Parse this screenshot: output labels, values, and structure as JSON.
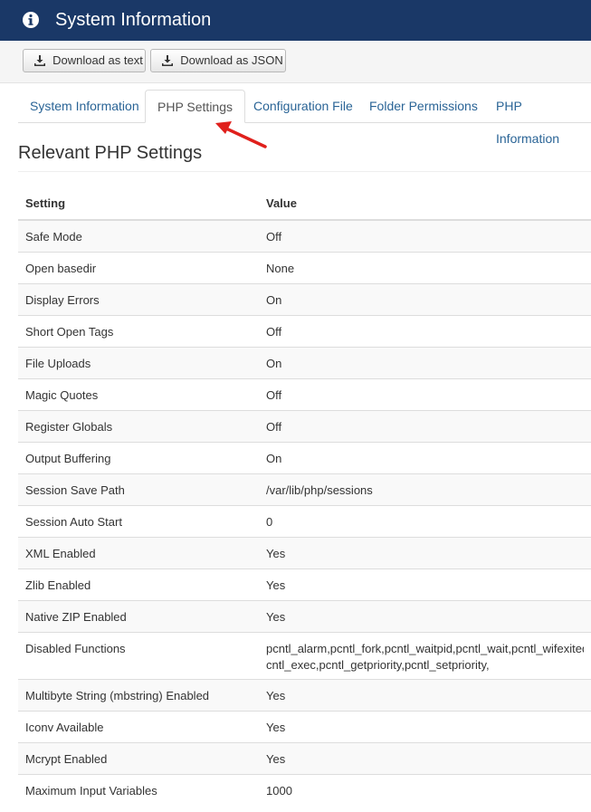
{
  "header": {
    "title": "System Information",
    "icon": "info-icon"
  },
  "toolbar": {
    "download_text": "Download as text",
    "download_json": "Download as JSON"
  },
  "tabs": [
    {
      "label": "System Information"
    },
    {
      "label": "PHP Settings",
      "active": true
    },
    {
      "label": "Configuration File"
    },
    {
      "label": "Folder Permissions"
    },
    {
      "label": "PHP Information"
    }
  ],
  "section": {
    "title": "Relevant PHP Settings"
  },
  "table": {
    "headers": {
      "setting": "Setting",
      "value": "Value"
    },
    "rows": [
      {
        "setting": "Safe Mode",
        "value": "Off"
      },
      {
        "setting": "Open basedir",
        "value": "None"
      },
      {
        "setting": "Display Errors",
        "value": "On"
      },
      {
        "setting": "Short Open Tags",
        "value": "Off"
      },
      {
        "setting": "File Uploads",
        "value": "On"
      },
      {
        "setting": "Magic Quotes",
        "value": "Off"
      },
      {
        "setting": "Register Globals",
        "value": "Off"
      },
      {
        "setting": "Output Buffering",
        "value": "On"
      },
      {
        "setting": "Session Save Path",
        "value": "/var/lib/php/sessions"
      },
      {
        "setting": "Session Auto Start",
        "value": "0"
      },
      {
        "setting": "XML Enabled",
        "value": "Yes"
      },
      {
        "setting": "Zlib Enabled",
        "value": "Yes"
      },
      {
        "setting": "Native ZIP Enabled",
        "value": "Yes"
      },
      {
        "setting": "Disabled Functions",
        "value_line1": "pcntl_alarm,pcntl_fork,pcntl_waitpid,pcntl_wait,pcntl_wifexited,",
        "value_line2": "cntl_exec,pcntl_getpriority,pcntl_setpriority,"
      },
      {
        "setting": "Multibyte String (mbstring) Enabled",
        "value": "Yes"
      },
      {
        "setting": "Iconv Available",
        "value": "Yes"
      },
      {
        "setting": "Mcrypt Enabled",
        "value": "Yes"
      },
      {
        "setting": "Maximum Input Variables",
        "value": "1000"
      }
    ]
  },
  "colors": {
    "header_bg": "#1a3867",
    "link": "#2a6496",
    "arrow": "#e0201c"
  }
}
